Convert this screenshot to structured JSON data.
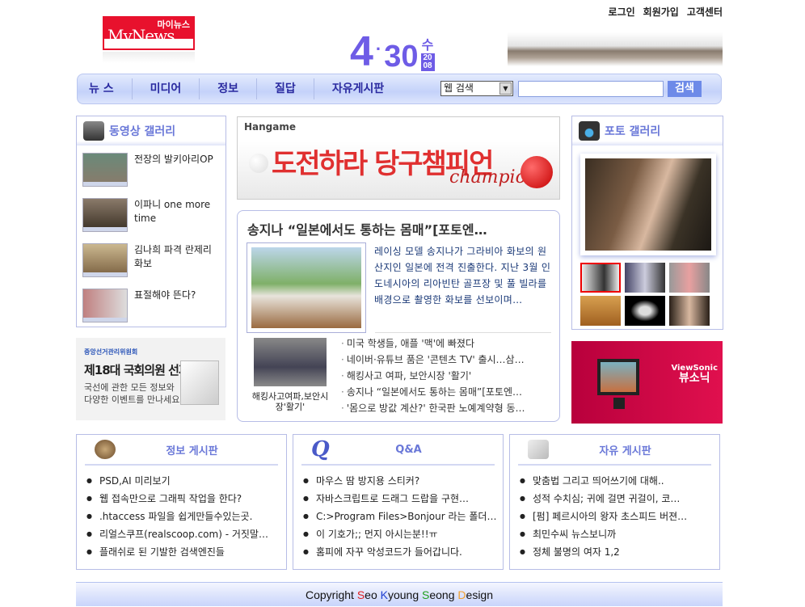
{
  "top_links": [
    "로그인",
    "회원가입",
    "고객센터"
  ],
  "logo": {
    "kr": "마이뉴스",
    "en": "MyNews"
  },
  "date": {
    "month": "4",
    "day": "30",
    "weekday": "수",
    "year_top": "20",
    "year_bottom": "08"
  },
  "nav": {
    "items": [
      "뉴 스",
      "미디어",
      "정보",
      "질답",
      "자유게시판"
    ],
    "search_select": "웹 검색",
    "search_value": "",
    "search_button": "검색"
  },
  "video_gallery": {
    "title": "동영상 갤러리",
    "items": [
      "전장의 발키아리OP",
      "이파니 one more time",
      "김나희 파격 란제리 화보",
      "표절해야 뜬다?"
    ]
  },
  "election_ad": {
    "org": "중앙선거관리위원회",
    "headline": "제18대 국회의원 선거",
    "sub1": "국선에 관한 모든 정보와",
    "sub2": "다양한 이벤트를 만나세요"
  },
  "banner": {
    "brand": "Hangame",
    "title": "도전하라 당구챔피언",
    "script": "champion"
  },
  "news": {
    "headline": "송지나 “일본에서도 통하는 몸매”[포토엔…",
    "summary": "레이싱 모델 송지나가 그라비아 화보의 원산지인 일본에 전격 진출한다. 지난 3월 인도네시아의 리아빈탄 골프장 및 풀 빌라를 배경으로 촬영한 화보를 선보이며…",
    "thumb_caption": "해킹사고여파,보안시장'활기'",
    "items": [
      "미국 학생들, 애플 '맥'에 빠졌다",
      "네이버·유튜브 품은 '콘텐츠 TV' 출시…삼…",
      "해킹사고 여파, 보안시장 '활기'",
      "송지나 “일본에서도 통하는 몸매”[포토엔…",
      "'몸으로 방값 계산?' 한국판 노예계약형 동…"
    ]
  },
  "photo_gallery": {
    "title": "포토 갤러리"
  },
  "viewsonic_ad": {
    "brand_en": "ViewSonic",
    "brand_kr": "뷰소닉"
  },
  "boards": [
    {
      "title": "정보 게시판",
      "items": [
        "PSD,AI 미리보기",
        "웹 접속만으로 그래픽 작업을 한다?",
        ".htaccess 파일을 쉽게만들수있는곳.",
        "리얼스쿠프(realscoop.com) - 거짓말…",
        "플래쉬로 된 기발한 검색엔진들"
      ]
    },
    {
      "title": "Q&A",
      "items": [
        "마우스 땀 방지용 스티커?",
        "자바스크립트로 드래그 드랍을 구현…",
        "C:>Program Files>Bonjour 라는 폴더…",
        "이 기호가;; 먼지 아시는분!!ㅠ",
        "홈피에 자꾸 악성코드가 들어갑니다."
      ]
    },
    {
      "title": "자유 게시판",
      "items": [
        "맞춤법 그리고 띄어쓰기에 대해..",
        "성적 수치심; 귀에 걸면 귀걸이, 코…",
        "[펌] 페르시아의 왕자 초스피드 버젼…",
        "최민수씨 뉴스보니까",
        "정체 불명의 여자 1,2"
      ]
    }
  ],
  "footer": {
    "prefix": "Copyright ",
    "s": "S",
    "eo": "eo ",
    "k": "K",
    "young": "young ",
    "s2": "S",
    "eong": "eong ",
    "d": "D",
    "esign": "esign"
  },
  "colors": {
    "accent": "#6e5ce6",
    "board_title": "#6a78d8",
    "logo_red": "#e8112d"
  }
}
